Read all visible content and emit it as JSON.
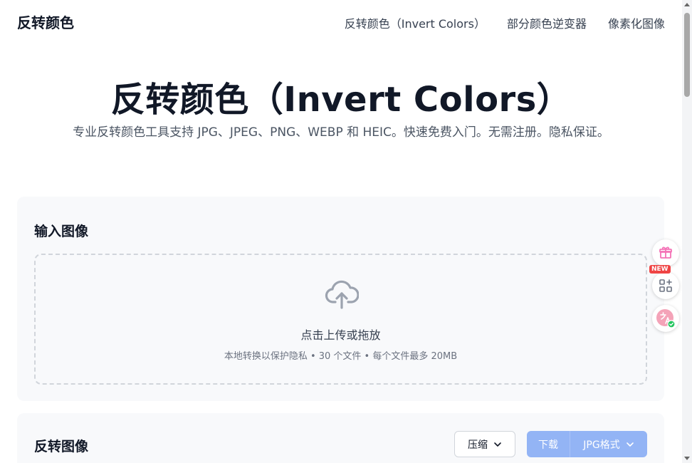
{
  "header": {
    "logo": "反转颜色",
    "nav": [
      "反转颜色（Invert Colors）",
      "部分颜色逆变器",
      "像素化图像"
    ]
  },
  "hero": {
    "title": "反转颜色（Invert Colors）",
    "subtitle": "专业反转颜色工具支持 JPG、JPEG、PNG、WEBP 和 HEIC。快速免费入门。无需注册。隐私保证。"
  },
  "input_section": {
    "title": "输入图像",
    "dropzone": {
      "icon": "cloud-upload-icon",
      "main_text": "点击上传或拖放",
      "hint": "本地转换以保护隐私 • 30 个文件 • 每个文件最多 20MB"
    }
  },
  "output_section": {
    "title": "反转图像",
    "compress_label": "压缩",
    "download_label": "下载",
    "format_label": "JPG格式"
  },
  "floating_toolbar": {
    "new_badge": "NEW",
    "icons": [
      "gift-icon",
      "apps-add-icon",
      "translate-icon"
    ]
  },
  "colors": {
    "primary_button": "#93b4f5",
    "badge": "#ef4444"
  }
}
